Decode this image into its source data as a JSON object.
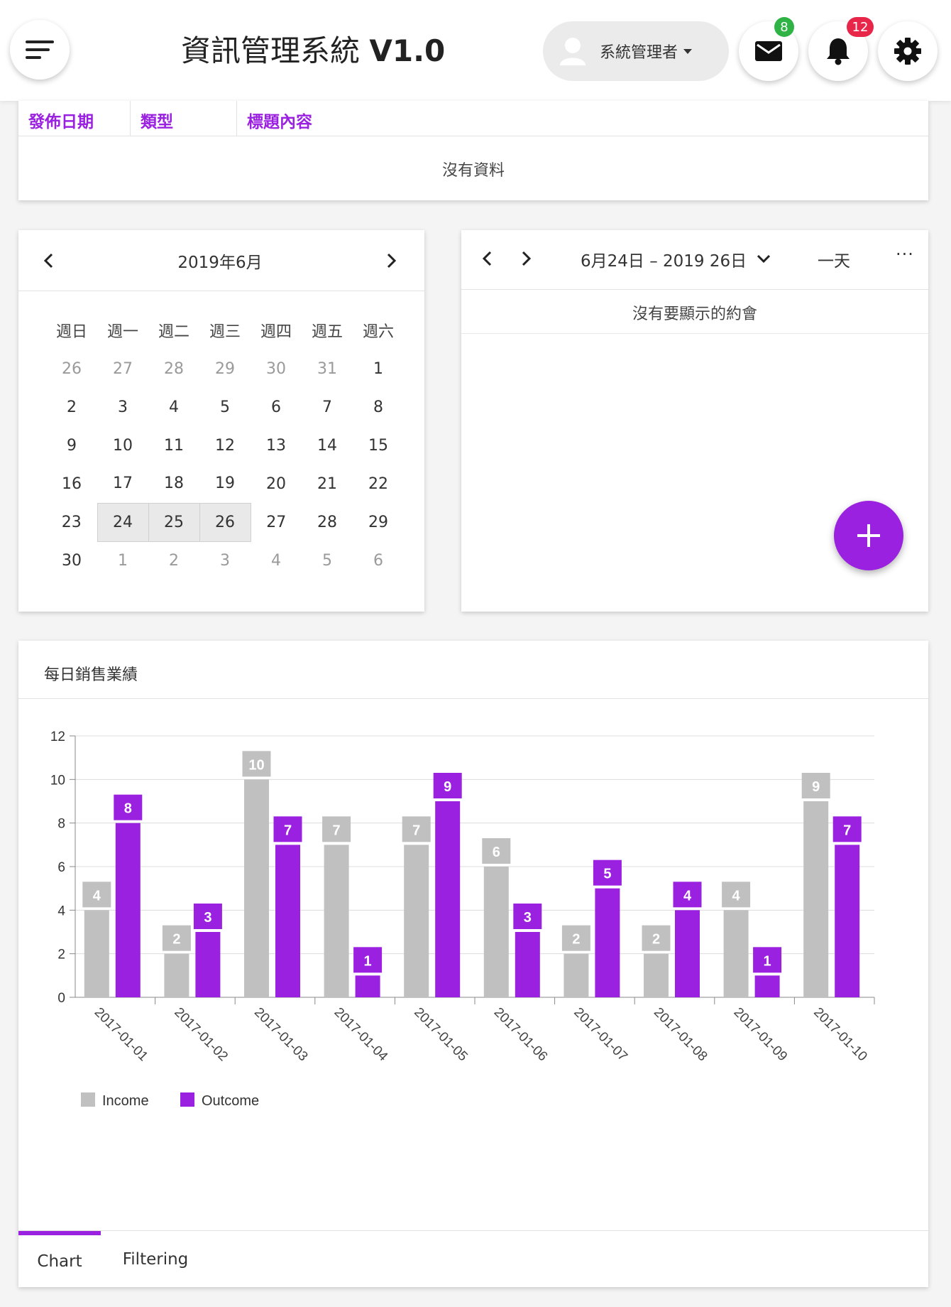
{
  "header": {
    "title": "資訊管理系統",
    "version": "V1.0",
    "user": "系統管理者",
    "mail_count": "8",
    "notify_count": "12"
  },
  "news": {
    "columns": [
      "發佈日期",
      "類型",
      "標題內容"
    ],
    "empty_text": "沒有資料"
  },
  "calendar": {
    "title": "2019年6月",
    "weekdays": [
      "週日",
      "週一",
      "週二",
      "週三",
      "週四",
      "週五",
      "週六"
    ],
    "weeks": [
      [
        {
          "d": "26",
          "o": true
        },
        {
          "d": "27",
          "o": true
        },
        {
          "d": "28",
          "o": true
        },
        {
          "d": "29",
          "o": true
        },
        {
          "d": "30",
          "o": true
        },
        {
          "d": "31",
          "o": true
        },
        {
          "d": "1"
        }
      ],
      [
        {
          "d": "2"
        },
        {
          "d": "3"
        },
        {
          "d": "4"
        },
        {
          "d": "5"
        },
        {
          "d": "6"
        },
        {
          "d": "7"
        },
        {
          "d": "8"
        }
      ],
      [
        {
          "d": "9"
        },
        {
          "d": "10"
        },
        {
          "d": "11"
        },
        {
          "d": "12"
        },
        {
          "d": "13"
        },
        {
          "d": "14"
        },
        {
          "d": "15"
        }
      ],
      [
        {
          "d": "16"
        },
        {
          "d": "17"
        },
        {
          "d": "18"
        },
        {
          "d": "19"
        },
        {
          "d": "20"
        },
        {
          "d": "21"
        },
        {
          "d": "22"
        }
      ],
      [
        {
          "d": "23"
        },
        {
          "d": "24",
          "s": true
        },
        {
          "d": "25",
          "s": true
        },
        {
          "d": "26",
          "s": true
        },
        {
          "d": "27"
        },
        {
          "d": "28"
        },
        {
          "d": "29"
        }
      ],
      [
        {
          "d": "30"
        },
        {
          "d": "1",
          "o": true
        },
        {
          "d": "2",
          "o": true
        },
        {
          "d": "3",
          "o": true
        },
        {
          "d": "4",
          "o": true
        },
        {
          "d": "5",
          "o": true
        },
        {
          "d": "6",
          "o": true
        }
      ]
    ]
  },
  "scheduler": {
    "range": "6月24日 – 2019 26日",
    "view": "一天",
    "more": "···",
    "empty_text": "沒有要顯示的約會"
  },
  "chart_card": {
    "title": "每日銷售業績",
    "tabs": [
      "Chart",
      "Filtering"
    ]
  },
  "colors": {
    "accent": "#9b21e0",
    "income": "#c0c0c0",
    "outcome": "#9b21e0"
  },
  "chart_data": {
    "type": "bar",
    "categories": [
      "2017-01-01",
      "2017-01-02",
      "2017-01-03",
      "2017-01-04",
      "2017-01-05",
      "2017-01-06",
      "2017-01-07",
      "2017-01-08",
      "2017-01-09",
      "2017-01-10"
    ],
    "series": [
      {
        "name": "Income",
        "values": [
          4,
          2,
          10,
          7,
          7,
          6,
          2,
          2,
          4,
          9
        ]
      },
      {
        "name": "Outcome",
        "values": [
          8,
          3,
          7,
          1,
          9,
          3,
          5,
          4,
          1,
          7
        ]
      }
    ],
    "yticks": [
      0,
      2,
      4,
      6,
      8,
      10,
      12
    ],
    "ylim": [
      0,
      12
    ],
    "grid": true,
    "legend": "bottom-left"
  }
}
